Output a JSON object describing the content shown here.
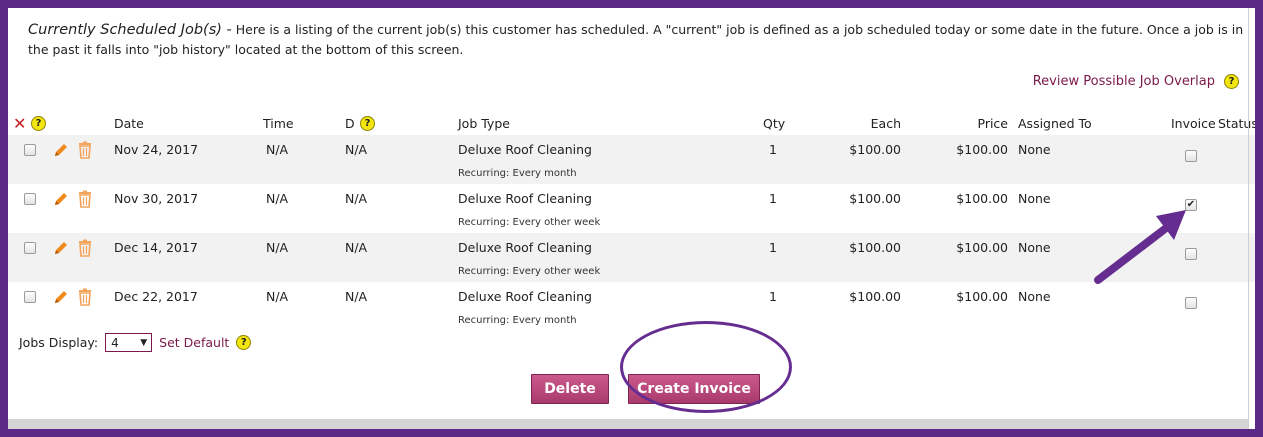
{
  "intro": {
    "title": "Currently Scheduled Job(s) -",
    "text": " Here is a listing of the current job(s) this customer has scheduled. A \"current\" job is defined as a job scheduled today or some date in the future. Once a job is in the past it falls into \"job history\" located at the bottom of this screen."
  },
  "overlap_link": "Review Possible Job Overlap",
  "help_glyph": "?",
  "columns": {
    "date": "Date",
    "time": "Time",
    "d": "D",
    "job_type": "Job Type",
    "qty": "Qty",
    "each": "Each",
    "price": "Price",
    "assigned_to": "Assigned To",
    "invoice": "Invoice",
    "status": "Status"
  },
  "jobs": [
    {
      "date": "Nov 24, 2017",
      "time": "N/A",
      "d": "N/A",
      "job_type": "Deluxe Roof Cleaning",
      "recurring": "Recurring: Every month",
      "qty": "1",
      "each": "$100.00",
      "price": "$100.00",
      "assigned_to": "None",
      "invoice_checked": false
    },
    {
      "date": "Nov 30, 2017",
      "time": "N/A",
      "d": "N/A",
      "job_type": "Deluxe Roof Cleaning",
      "recurring": "Recurring: Every other week",
      "qty": "1",
      "each": "$100.00",
      "price": "$100.00",
      "assigned_to": "None",
      "invoice_checked": true
    },
    {
      "date": "Dec 14, 2017",
      "time": "N/A",
      "d": "N/A",
      "job_type": "Deluxe Roof Cleaning",
      "recurring": "Recurring: Every other week",
      "qty": "1",
      "each": "$100.00",
      "price": "$100.00",
      "assigned_to": "None",
      "invoice_checked": false
    },
    {
      "date": "Dec 22, 2017",
      "time": "N/A",
      "d": "N/A",
      "job_type": "Deluxe Roof Cleaning",
      "recurring": "Recurring: Every month",
      "qty": "1",
      "each": "$100.00",
      "price": "$100.00",
      "assigned_to": "None",
      "invoice_checked": false
    }
  ],
  "jobs_display": {
    "label": "Jobs Display:",
    "value": "4",
    "set_default": "Set Default"
  },
  "buttons": {
    "delete": "Delete",
    "create_invoice": "Create Invoice"
  },
  "colors": {
    "frame": "#5c2a86",
    "accent_link": "#7b1a4a",
    "button": "#b8467a",
    "annotation": "#662d91",
    "pencil": "#f08a1c",
    "trash": "#f3a35a"
  },
  "icons": {
    "delete_all": "x-icon",
    "help": "help-icon",
    "edit": "pencil-icon",
    "remove": "trash-icon",
    "annotation_arrow": "arrow-icon",
    "dropdown": "caret-down-icon"
  }
}
